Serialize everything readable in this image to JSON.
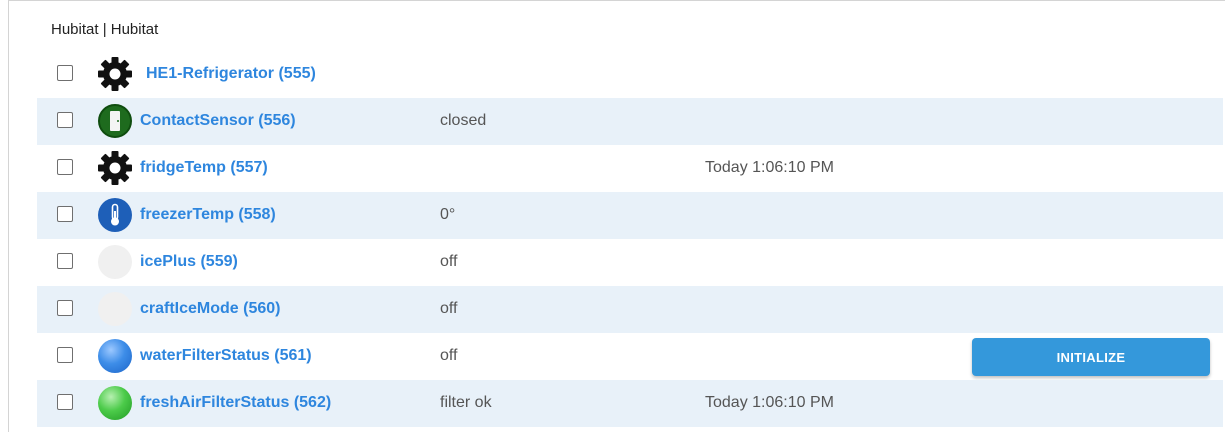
{
  "group": {
    "header": "Hubitat | Hubitat"
  },
  "devices": [
    {
      "name": "HE1-Refrigerator  (555)",
      "icon": "gear-icon",
      "state": "",
      "time": ""
    },
    {
      "name": "ContactSensor (556)",
      "icon": "contact-door-icon",
      "state": "closed",
      "time": ""
    },
    {
      "name": "fridgeTemp (557)",
      "icon": "gear-icon",
      "state": "",
      "time": "Today 1:06:10 PM"
    },
    {
      "name": "freezerTemp (558)",
      "icon": "thermometer-icon",
      "state": "0°",
      "time": ""
    },
    {
      "name": "icePlus (559)",
      "icon": "blank-icon",
      "state": "off",
      "time": ""
    },
    {
      "name": "craftIceMode (560)",
      "icon": "blank-icon",
      "state": "off",
      "time": ""
    },
    {
      "name": "waterFilterStatus (561)",
      "icon": "blue-sphere-icon",
      "state": "off",
      "time": "",
      "button": "INITIALIZE"
    },
    {
      "name": "freshAirFilterStatus (562)",
      "icon": "green-sphere-icon",
      "state": "filter ok",
      "time": "Today 1:06:10 PM"
    }
  ],
  "colors": {
    "link": "#2e86de",
    "row_alt": "#e8f1f9",
    "button": "#3498db"
  }
}
